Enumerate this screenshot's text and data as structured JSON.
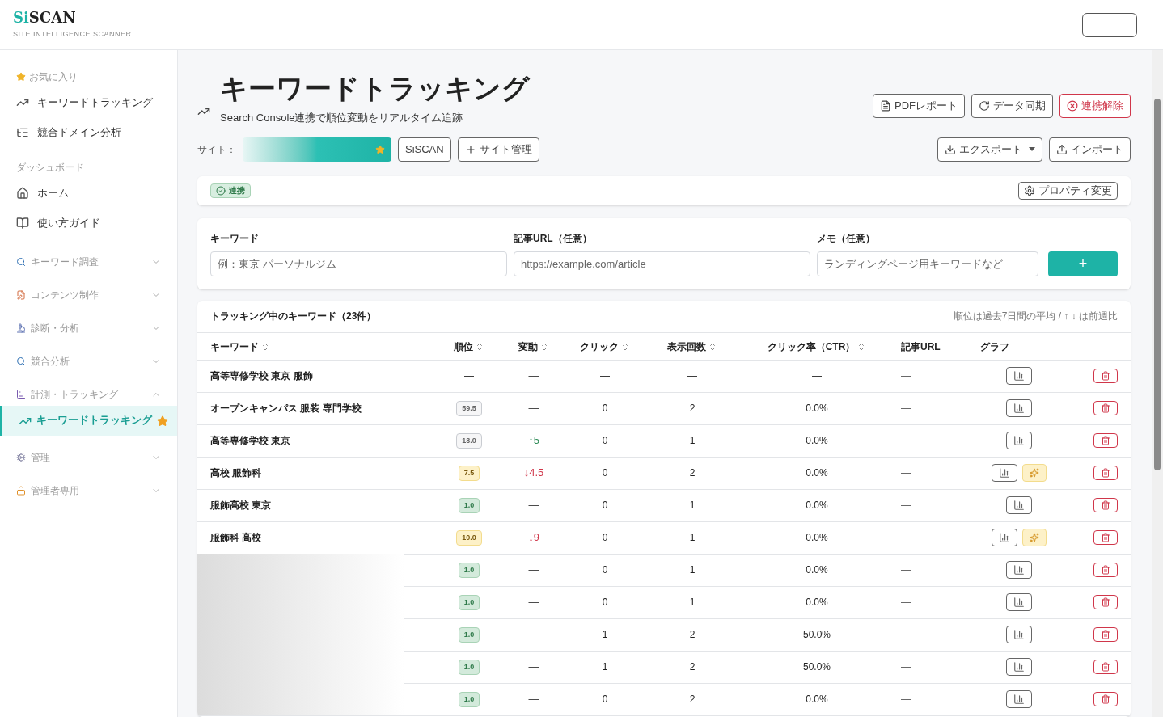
{
  "logo": {
    "name": "SiSCAN",
    "tagline": "SITE INTELLIGENCE SCANNER"
  },
  "sidebar": {
    "sections": [
      {
        "kind": "plain",
        "title": "お気に入り",
        "items": [
          {
            "label": "キーワードトラッキング",
            "selected": false
          },
          {
            "label": "競合ドメイン分析",
            "selected": false
          }
        ]
      },
      {
        "kind": "plain",
        "title": "ダッシュボード",
        "items": [
          {
            "label": "ホーム",
            "selected": false
          },
          {
            "label": "使い方ガイド",
            "selected": false
          }
        ]
      },
      {
        "kind": "group",
        "title": "キーワード調査",
        "expanded": false
      },
      {
        "kind": "group",
        "title": "コンテンツ制作",
        "expanded": false
      },
      {
        "kind": "group",
        "title": "診断・分析",
        "expanded": false
      },
      {
        "kind": "group",
        "title": "競合分析",
        "expanded": false
      },
      {
        "kind": "group",
        "title": "計測・トラッキング",
        "expanded": true,
        "items": [
          {
            "label": "キーワードトラッキング",
            "selected": true,
            "favorite": true
          }
        ]
      },
      {
        "kind": "group",
        "title": "管理",
        "expanded": false
      },
      {
        "kind": "group",
        "title": "管理者専用",
        "expanded": false
      }
    ]
  },
  "page": {
    "title": "キーワードトラッキング",
    "subtitle": "Search Console連携で順位変動をリアルタイム追跡",
    "actions": [
      {
        "label": "PDFレポート",
        "kind": "normal"
      },
      {
        "label": "データ同期",
        "kind": "normal"
      },
      {
        "label": "連携解除",
        "kind": "danger"
      }
    ],
    "site_label": "サイト：",
    "site_buttons": [
      "SiSCAN",
      "サイト管理"
    ],
    "io_buttons": [
      "エクスポート",
      "インポート"
    ],
    "status_badge": "連携",
    "property_button": "プロパティ変更"
  },
  "form": {
    "fields": [
      {
        "label": "キーワード",
        "placeholder": "例：東京 パーソナルジム"
      },
      {
        "label": "記事URL（任意）",
        "placeholder": "https://example.com/article"
      },
      {
        "label": "メモ（任意）",
        "placeholder": "ランディングページ用キーワードなど"
      }
    ],
    "add_button": "+"
  },
  "table": {
    "title": "トラッキング中のキーワード（23件）",
    "note": "順位は過去7日間の平均 / ↑ ↓ は前週比",
    "columns": [
      {
        "label": "キーワード",
        "sortable": true
      },
      {
        "label": "順位",
        "sortable": true
      },
      {
        "label": "変動",
        "sortable": true
      },
      {
        "label": "クリック",
        "sortable": true
      },
      {
        "label": "表示回数",
        "sortable": true
      },
      {
        "label": "クリック率（CTR）",
        "sortable": true
      },
      {
        "label": "記事URL",
        "sortable": false
      },
      {
        "label": "グラフ",
        "sortable": false
      }
    ],
    "rows": [
      {
        "keyword": "高等専修学校 東京 服飾",
        "rank": {
          "text": "—",
          "kind": "plain"
        },
        "change": {
          "text": "—",
          "kind": "flat"
        },
        "clicks": "—",
        "impressions": "—",
        "ctr": "—",
        "url": "—",
        "suggest": false
      },
      {
        "keyword": "オープンキャンパス 服装 専門学校",
        "rank": {
          "text": "59.5",
          "kind": "gray"
        },
        "change": {
          "text": "—",
          "kind": "flat"
        },
        "clicks": "0",
        "impressions": "2",
        "ctr": "0.0%",
        "url": "—",
        "suggest": false
      },
      {
        "keyword": "高等専修学校 東京",
        "rank": {
          "text": "13.0",
          "kind": "gray"
        },
        "change": {
          "text": "↑5",
          "kind": "up"
        },
        "clicks": "0",
        "impressions": "1",
        "ctr": "0.0%",
        "url": "—",
        "suggest": false
      },
      {
        "keyword": "高校 服飾科",
        "rank": {
          "text": "7.5",
          "kind": "yellow"
        },
        "change": {
          "text": "↓4.5",
          "kind": "down"
        },
        "clicks": "0",
        "impressions": "2",
        "ctr": "0.0%",
        "url": "—",
        "suggest": true
      },
      {
        "keyword": "服飾高校 東京",
        "rank": {
          "text": "1.0",
          "kind": "green"
        },
        "change": {
          "text": "—",
          "kind": "flat"
        },
        "clicks": "0",
        "impressions": "1",
        "ctr": "0.0%",
        "url": "—",
        "suggest": false
      },
      {
        "keyword": "服飾科 高校",
        "rank": {
          "text": "10.0",
          "kind": "yellow"
        },
        "change": {
          "text": "↓9",
          "kind": "down"
        },
        "clicks": "0",
        "impressions": "1",
        "ctr": "0.0%",
        "url": "—",
        "suggest": true
      },
      {
        "rank": {
          "text": "1.0",
          "kind": "green"
        },
        "change": {
          "text": "—",
          "kind": "flat"
        },
        "clicks": "0",
        "impressions": "1",
        "ctr": "0.0%",
        "url": "—",
        "suggest": false
      },
      {
        "rank": {
          "text": "1.0",
          "kind": "green"
        },
        "change": {
          "text": "—",
          "kind": "flat"
        },
        "clicks": "0",
        "impressions": "1",
        "ctr": "0.0%",
        "url": "—",
        "suggest": false
      },
      {
        "rank": {
          "text": "1.0",
          "kind": "green"
        },
        "change": {
          "text": "—",
          "kind": "flat"
        },
        "clicks": "1",
        "impressions": "2",
        "ctr": "50.0%",
        "url": "—",
        "suggest": false
      },
      {
        "rank": {
          "text": "1.0",
          "kind": "green"
        },
        "change": {
          "text": "—",
          "kind": "flat"
        },
        "clicks": "1",
        "impressions": "2",
        "ctr": "50.0%",
        "url": "—",
        "suggest": false
      },
      {
        "rank": {
          "text": "1.0",
          "kind": "green"
        },
        "change": {
          "text": "—",
          "kind": "flat"
        },
        "clicks": "0",
        "impressions": "2",
        "ctr": "0.0%",
        "url": "—",
        "suggest": false
      }
    ]
  }
}
